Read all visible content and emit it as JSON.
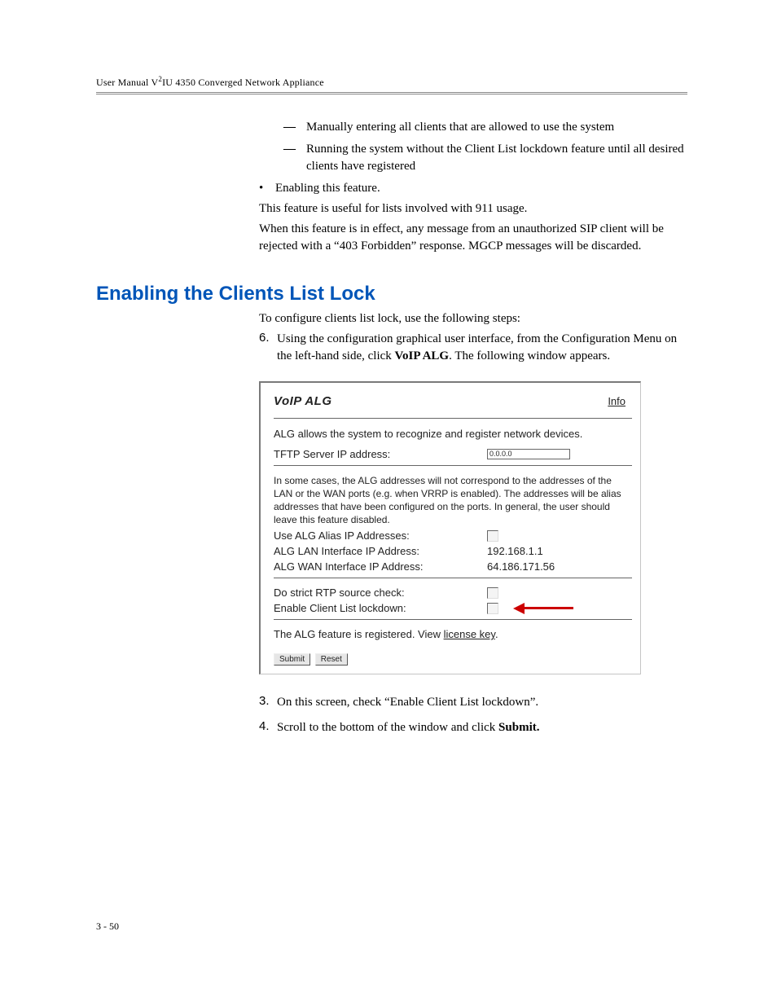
{
  "header": {
    "text": "User Manual V²IU 4350 Converged Network Appliance"
  },
  "top": {
    "dash1": "Manually entering all clients that are allowed to use the system",
    "dash2": "Running the system without the Client List lockdown feature until all desired clients have registered",
    "bullet": "Enabling this feature.",
    "para1": "This feature is useful for lists involved with 911 usage.",
    "para2": "When this feature is in effect, any message from an unauthorized SIP client will be rejected with a “403 Forbidden” response. MGCP messages will be discarded."
  },
  "heading": "Enabling the Clients List Lock",
  "intro": "To configure clients list lock, use the following steps:",
  "step6_a": "Using the configuration graphical user interface, from the Configuration Menu on the left-hand side, click ",
  "step6_bold": "VoIP ALG",
  "step6_b": ". The following window appears.",
  "shot": {
    "title": "VoIP ALG",
    "info": "Info",
    "desc": "ALG allows the system to recognize and register network devices.",
    "tftp_label": "TFTP Server IP address:",
    "tftp_value": "0.0.0.0",
    "note": "In some cases, the ALG addresses will not correspond to the addresses of the LAN or the WAN ports (e.g. when VRRP is enabled). The addresses will be alias addresses that have been configured on the ports. In general, the user should leave this feature disabled.",
    "alias_label": "Use ALG Alias IP Addresses:",
    "lan_label": "ALG LAN Interface IP Address:",
    "lan_value": "192.168.1.1",
    "wan_label": "ALG WAN Interface IP Address:",
    "wan_value": "64.186.171.56",
    "rtp_label": "Do strict RTP source check:",
    "lock_label": "Enable Client List lockdown:",
    "license_a": "The ALG feature is registered. View ",
    "license_link": "license key",
    "license_b": ".",
    "submit": "Submit",
    "reset": "Reset"
  },
  "step3_a": "On this screen, check “Enable Client List lockdown”.",
  "step4_a": "Scroll to the bottom of the window and click ",
  "step4_bold": "Submit.",
  "footer": "3 - 50"
}
